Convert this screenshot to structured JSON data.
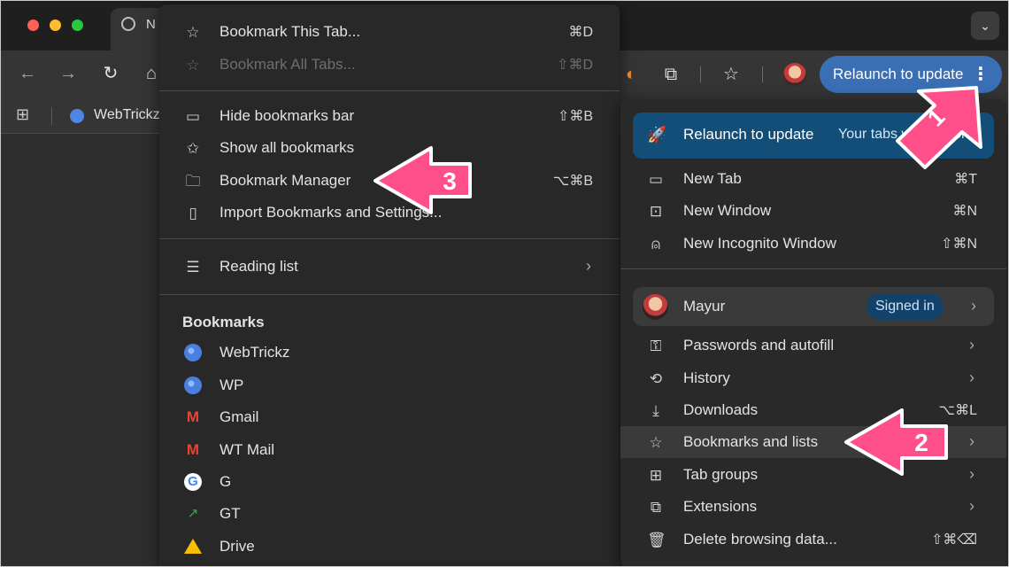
{
  "browser": {
    "tab_title": "N",
    "toolbar": {
      "relaunch_label": "Relaunch to update",
      "relaunch_dots": "⋮"
    },
    "bookmarks_bar": {
      "item_label": "WebTrickz"
    }
  },
  "bookmarks_menu": {
    "group1": [
      {
        "label": "Bookmark This Tab...",
        "shortcut": "⌘D",
        "icon": "star-icon",
        "disabled": false
      },
      {
        "label": "Bookmark All Tabs...",
        "shortcut": "⇧⌘D",
        "icon": "star-icon",
        "disabled": true
      }
    ],
    "group2": [
      {
        "label": "Hide bookmarks bar",
        "shortcut": "⇧⌘B",
        "icon": "bookmarks-bar-icon"
      },
      {
        "label": "Show all bookmarks",
        "shortcut": "",
        "icon": "star-list-icon"
      },
      {
        "label": "Bookmark Manager",
        "shortcut": "⌥⌘B",
        "icon": "folder-icon"
      },
      {
        "label": "Import Bookmarks and Settings...",
        "shortcut": "",
        "icon": "book-icon"
      }
    ],
    "reading_list": {
      "label": "Reading list",
      "icon": "reading-list-icon"
    },
    "section_title": "Bookmarks",
    "bookmarks": [
      {
        "label": "WebTrickz",
        "icon": "globe-icon"
      },
      {
        "label": "WP",
        "icon": "globe-icon"
      },
      {
        "label": "Gmail",
        "icon": "gmail-icon"
      },
      {
        "label": "WT Mail",
        "icon": "gmail-icon"
      },
      {
        "label": "G",
        "icon": "google-icon"
      },
      {
        "label": "GT",
        "icon": "trends-icon"
      },
      {
        "label": "Drive",
        "icon": "drive-icon"
      }
    ]
  },
  "main_menu": {
    "banner": {
      "label": "Relaunch to update",
      "sub": "Your tabs will reopen"
    },
    "group1": [
      {
        "label": "New Tab",
        "shortcut": "⌘T",
        "icon": "new-tab-icon"
      },
      {
        "label": "New Window",
        "shortcut": "⌘N",
        "icon": "new-window-icon"
      },
      {
        "label": "New Incognito Window",
        "shortcut": "⇧⌘N",
        "icon": "incognito-icon"
      }
    ],
    "profile": {
      "name": "Mayur",
      "badge": "Signed in"
    },
    "group2": [
      {
        "label": "Passwords and autofill",
        "shortcut": "",
        "icon": "key-icon",
        "chevron": true
      },
      {
        "label": "History",
        "shortcut": "",
        "icon": "history-icon",
        "chevron": true
      },
      {
        "label": "Downloads",
        "shortcut": "⌥⌘L",
        "icon": "download-icon",
        "chevron": false
      },
      {
        "label": "Bookmarks and lists",
        "shortcut": "",
        "icon": "star-icon",
        "chevron": true
      },
      {
        "label": "Tab groups",
        "shortcut": "",
        "icon": "tab-groups-icon",
        "chevron": true
      },
      {
        "label": "Extensions",
        "shortcut": "",
        "icon": "puzzle-icon",
        "chevron": true
      },
      {
        "label": "Delete browsing data...",
        "shortcut": "⇧⌘⌫",
        "icon": "trash-icon",
        "chevron": false
      }
    ]
  },
  "annotations": {
    "step1": "1",
    "step2": "2",
    "step3": "3",
    "arrow_color": "#ff4f8b"
  }
}
